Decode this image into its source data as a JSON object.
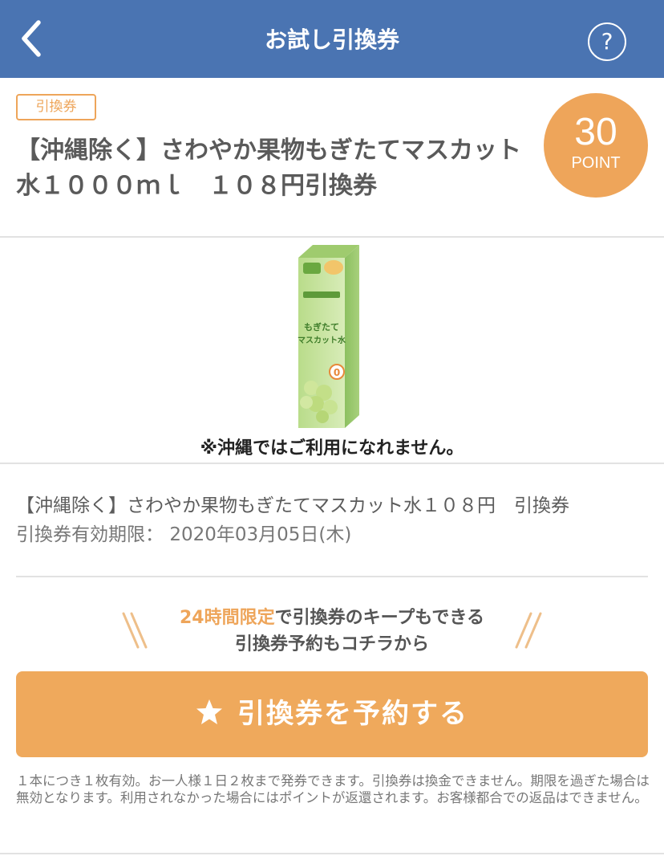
{
  "header": {
    "title": "お試し引換券",
    "back_icon": "chevron-left-icon",
    "help_label": "?"
  },
  "coupon": {
    "badge": "引換券",
    "title": "【沖縄除く】さわやか果物もぎたてマスカット水１０００ｍｌ　１０８円引換券",
    "points_value": "30",
    "points_unit": "POINT"
  },
  "image": {
    "note": "※沖縄ではご利用になれません。"
  },
  "detail": {
    "name": "【沖縄除く】さわやか果物もぎたてマスカット水１０８円　引換券",
    "expiry_label": "引換券有効期限：",
    "expiry_value": "2020年03月05日(木)"
  },
  "keep": {
    "highlight": "24時間限定",
    "line1_rest": "で引換券のキープもできる",
    "line2": "引換券予約もコチラから"
  },
  "reserve": {
    "icon": "star-icon",
    "label": "引換券を予約する"
  },
  "notes": "１本につき１枚有効。お一人様１日２枚まで発券できます。引換券は換金できません。期限を過ぎた場合は無効となります。利用されなかった場合にはポイントが返還されます。お客様都合での返品はできません。",
  "colors": {
    "header_bg": "#4a74b2",
    "accent": "#eea55a"
  }
}
